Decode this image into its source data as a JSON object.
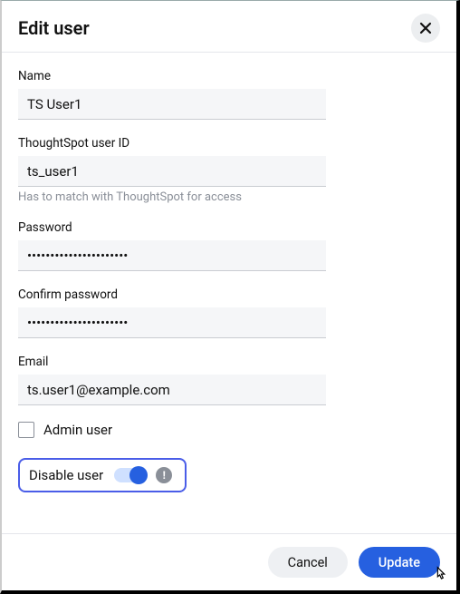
{
  "dialog": {
    "title": "Edit user"
  },
  "fields": {
    "name": {
      "label": "Name",
      "value": "TS User1"
    },
    "userid": {
      "label": "ThoughtSpot user ID",
      "value": "ts_user1",
      "helper": "Has to match with ThoughtSpot for access"
    },
    "password": {
      "label": "Password",
      "value": "••••••••••••••••••••••"
    },
    "confirm": {
      "label": "Confirm password",
      "value": "••••••••••••••••••••••"
    },
    "email": {
      "label": "Email",
      "value": "ts.user1@example.com"
    }
  },
  "admin": {
    "label": "Admin user",
    "checked": false
  },
  "disable": {
    "label": "Disable user",
    "on": true
  },
  "buttons": {
    "cancel": "Cancel",
    "update": "Update"
  }
}
